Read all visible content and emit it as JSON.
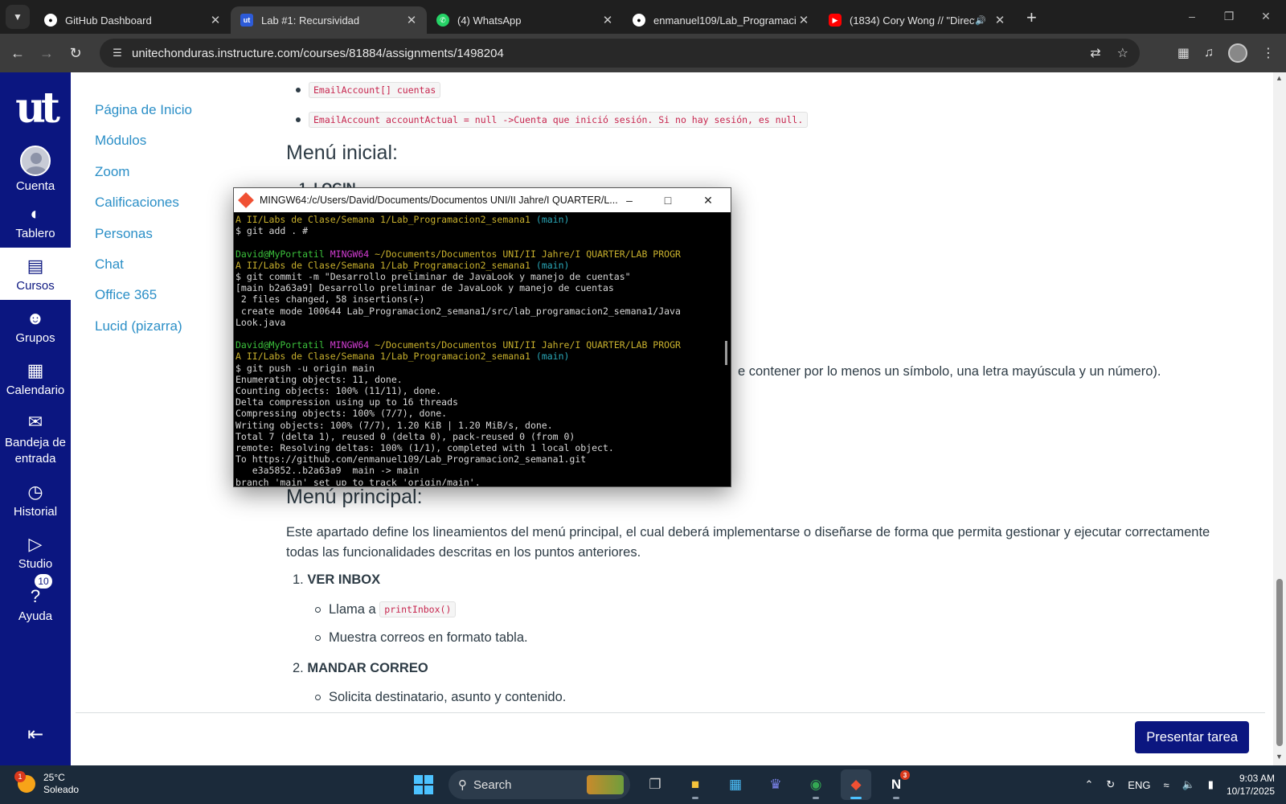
{
  "browser": {
    "tabs": [
      {
        "title": "GitHub Dashboard",
        "icon": "github-icon",
        "active": false
      },
      {
        "title": "Lab #1: Recursividad",
        "icon": "canvas-icon",
        "active": true
      },
      {
        "title": "(4) WhatsApp",
        "icon": "whatsapp-icon",
        "active": false
      },
      {
        "title": "enmanuel109/Lab_Programacio",
        "icon": "github-icon",
        "active": false
      },
      {
        "title": "(1834) Cory Wong // \"Direct",
        "icon": "youtube-icon",
        "active": false
      }
    ],
    "url": "unitechonduras.instructure.com/courses/81884/assignments/1498204"
  },
  "global_nav": {
    "logo": "ut",
    "items": [
      {
        "label": "Cuenta",
        "icon": "avatar-icon"
      },
      {
        "label": "Tablero",
        "icon": "dashboard-icon"
      },
      {
        "label": "Cursos",
        "icon": "book-icon",
        "active": true
      },
      {
        "label": "Grupos",
        "icon": "groups-icon"
      },
      {
        "label": "Calendario",
        "icon": "calendar-icon"
      },
      {
        "label": "Bandeja de entrada",
        "icon": "inbox-icon"
      },
      {
        "label": "Historial",
        "icon": "clock-icon"
      },
      {
        "label": "Studio",
        "icon": "studio-icon"
      },
      {
        "label": "Ayuda",
        "icon": "help-icon",
        "badge": "10"
      }
    ]
  },
  "course_nav": [
    "Página de Inicio",
    "Módulos",
    "Zoom",
    "Calificaciones",
    "Personas",
    "Chat",
    "Office 365",
    "Lucid (pizarra)"
  ],
  "content": {
    "code_cuentas": "EmailAccount[] cuentas",
    "code_actual": "EmailAccount accountActual = null ->Cuenta que inició sesión. Si no hay sesión, es null.",
    "heading_menu_inicial": "Menú inicial:",
    "partial_login": "1. LOGIN",
    "partial_password_text": "e contener por lo menos un símbolo, una letra mayúscula y un número).",
    "heading_menu_principal": "Menú principal:",
    "paragraph": "Este apartado define los lineamientos del menú principal, el cual deberá implementarse o diseñarse de forma que permita gestionar y ejecutar correctamente todas las funcionalidades descritas en los puntos anteriores.",
    "item1_num": "1.",
    "item1_title": "VER INBOX",
    "item1_sub1_prefix": "Llama a",
    "item1_sub1_code": "printInbox()",
    "item1_sub2": "Muestra correos en formato tabla.",
    "item2_num": "2.",
    "item2_title": "MANDAR CORREO",
    "item2_sub1": "Solicita destinatario, asunto y contenido.",
    "submit_label": "Presentar tarea"
  },
  "terminal": {
    "title": "MINGW64:/c/Users/David/Documents/Documentos UNI/II Jahre/I QUARTER/L...",
    "lines": {
      "l01_path": "A II/Labs de Clase/Semana 1/Lab_Programacion2_semana1",
      "l01_branch": "(main)",
      "l02": "$ git add . #",
      "l04_user": "David@MyPortatil",
      "l04_sys": "MINGW64",
      "l04_path": "~/Documents/Documentos UNI/II Jahre/I QUARTER/LAB PROGR",
      "l05_path": "A II/Labs de Clase/Semana 1/Lab_Programacion2_semana1",
      "l05_branch": "(main)",
      "l06": "$ git commit -m \"Desarrollo preliminar de JavaLook y manejo de cuentas\"",
      "l07": "[main b2a63a9] Desarrollo preliminar de JavaLook y manejo de cuentas",
      "l08": " 2 files changed, 58 insertions(+)",
      "l09": " create mode 100644 Lab_Programacion2_semana1/src/lab_programacion2_semana1/Java",
      "l10": "Look.java",
      "l12_user": "David@MyPortatil",
      "l12_sys": "MINGW64",
      "l12_path": "~/Documents/Documentos UNI/II Jahre/I QUARTER/LAB PROGR",
      "l13_path": "A II/Labs de Clase/Semana 1/Lab_Programacion2_semana1",
      "l13_branch": "(main)",
      "l14": "$ git push -u origin main",
      "l15": "Enumerating objects: 11, done.",
      "l16": "Counting objects: 100% (11/11), done.",
      "l17": "Delta compression using up to 16 threads",
      "l18": "Compressing objects: 100% (7/7), done.",
      "l19": "Writing objects: 100% (7/7), 1.20 KiB | 1.20 MiB/s, done.",
      "l20": "Total 7 (delta 1), reused 0 (delta 0), pack-reused 0 (from 0)",
      "l21": "remote: Resolving deltas: 100% (1/1), completed with 1 local object.",
      "l22": "To https://github.com/enmanuel109/Lab_Programacion2_semana1.git",
      "l23": "   e3a5852..b2a63a9  main -> main",
      "l24": "branch 'main' set up to track 'origin/main'."
    }
  },
  "taskbar": {
    "weather_temp": "25°C",
    "weather_desc": "Soleado",
    "weather_badge": "1",
    "search_label": "Search",
    "teams_badge": "",
    "notion_badge": "3",
    "language": "ENG",
    "time": "9:03 AM",
    "date": "10/17/2025"
  },
  "colors": {
    "canvas_nav": "#0b1680",
    "link": "#2b8fc7",
    "code_red": "#c7254e"
  }
}
